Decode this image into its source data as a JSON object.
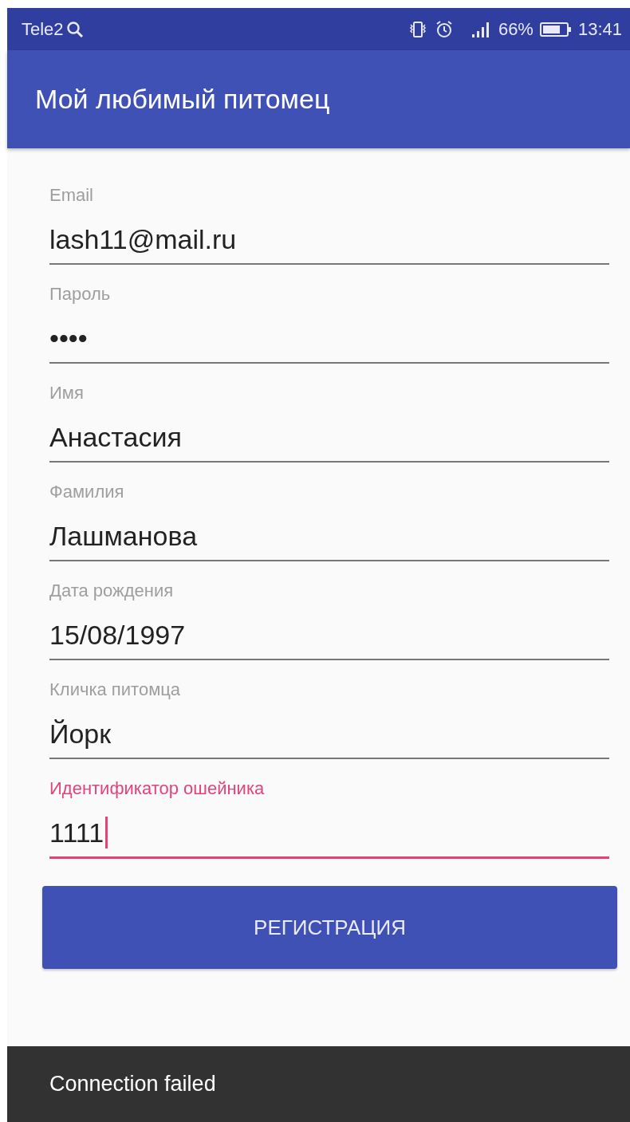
{
  "status_bar": {
    "carrier": "Tele2",
    "battery": "66%",
    "time": "13:41"
  },
  "app_bar": {
    "title": "Мой любимый питомец"
  },
  "fields": [
    {
      "label": "Email",
      "value": "lash11@mail.ru",
      "focused": false
    },
    {
      "label": "Пароль",
      "value": "••••",
      "focused": false
    },
    {
      "label": "Имя",
      "value": "Анастасия",
      "focused": false
    },
    {
      "label": "Фамилия",
      "value": "Лашманова",
      "focused": false
    },
    {
      "label": "Дата рождения",
      "value": "15/08/1997",
      "focused": false
    },
    {
      "label": "Кличка питомца",
      "value": "Йорк",
      "focused": false
    },
    {
      "label": "Идентификатор ошейника",
      "value": "1111",
      "focused": true
    }
  ],
  "button": {
    "label": "РЕГИСТРАЦИЯ"
  },
  "snackbar": {
    "message": "Connection failed"
  }
}
